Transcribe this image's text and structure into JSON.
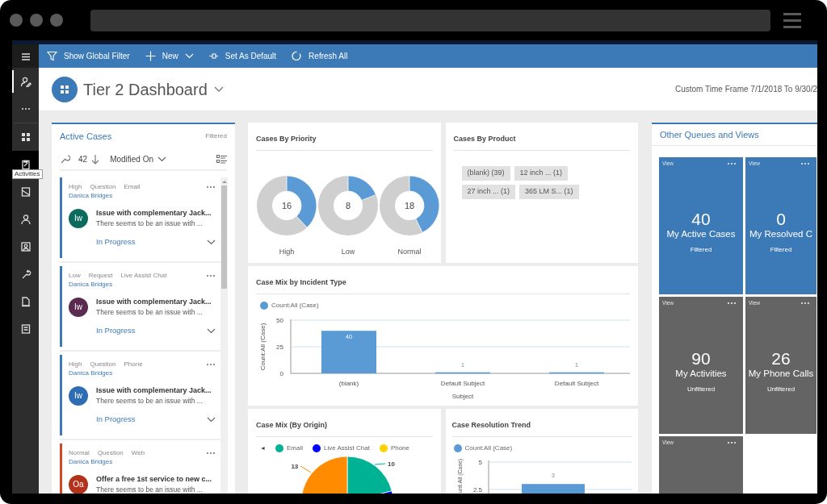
{
  "nav_rail": {
    "items": [
      {
        "selected": false,
        "hovered": false
      },
      {
        "selected": true,
        "hovered": false
      },
      {
        "selected": false,
        "hovered": false
      },
      {
        "selected": false,
        "hovered": false
      },
      {
        "selected": false,
        "hovered": true
      },
      {
        "selected": false,
        "hovered": false
      },
      {
        "selected": false,
        "hovered": false
      },
      {
        "selected": false,
        "hovered": false
      },
      {
        "selected": false,
        "hovered": false
      },
      {
        "selected": false,
        "hovered": false
      },
      {
        "selected": false,
        "hovered": false
      }
    ],
    "tooltip": "Activities"
  },
  "command_bar": [
    {
      "label": "Show Global Filter",
      "dropdown": false
    },
    {
      "label": "New",
      "dropdown": true
    },
    {
      "label": "Set As Default",
      "dropdown": false
    },
    {
      "label": "Refresh All",
      "dropdown": false
    }
  ],
  "header": {
    "title": "Tier 2 Dashboard",
    "time_frame": "Custom Time Frame 7/1/2018 To 9/30/2"
  },
  "active_cases": {
    "title": "Active Cases",
    "filter_label": "Filtered",
    "count": "42",
    "sort_field": "Modified On",
    "cases": [
      {
        "tags": [
          "High",
          "Question",
          "Email"
        ],
        "owner": "Danica Bridges",
        "avatar": {
          "initials": "Iw",
          "color": "#0d6b5e"
        },
        "title": "Issue with complementary Jack...",
        "description": "There seems to be an issue with ...",
        "status": "In Progress",
        "color": "#3b79b7"
      },
      {
        "tags": [
          "Low",
          "Request",
          "Live Assist Chat"
        ],
        "owner": "Danica Bridges",
        "avatar": {
          "initials": "Iw",
          "color": "#5b2a4f"
        },
        "title": "Issue with complementary Jack...",
        "description": "There seems to be an issue with ...",
        "status": "In Progress",
        "color": "#3b79b7"
      },
      {
        "tags": [
          "High",
          "Question",
          "Phone"
        ],
        "owner": "Danica Bridges",
        "avatar": {
          "initials": "Iw",
          "color": "#2e6db4"
        },
        "title": "Issue with complementary Jack...",
        "description": "There seems to be an issue with ...",
        "status": "In Progress",
        "color": "#3b79b7"
      },
      {
        "tags": [
          "Normal",
          "Question",
          "Web"
        ],
        "owner": "Danica Bridges",
        "avatar": {
          "initials": "Oa",
          "color": "#b3321b"
        },
        "title": "Offer a free 1st service to new c...",
        "description": "There seems to be an issue with ...",
        "color": "#d24726"
      }
    ]
  },
  "cases_by_priority": {
    "title": "Cases By Priority",
    "donuts": [
      {
        "label": "High",
        "count": "16"
      },
      {
        "label": "Low",
        "count": "8"
      },
      {
        "label": "Normal",
        "count": "18"
      }
    ]
  },
  "cases_by_product": {
    "title": "Cases By Product",
    "tags": [
      "(blank) (39)",
      "12 inch ... (1)",
      "27 inch ... (1)",
      "365 LM S... (1)"
    ]
  },
  "incident_chart": {
    "title": "Case Mix by Incident Type",
    "chart_data": {
      "type": "bar",
      "xlabel": "Subject",
      "ylabel": "Count:All (Case)",
      "categories": [
        "(blank)",
        "Default Subject",
        "Default Subject"
      ],
      "series": [
        {
          "name": "Count:All (Case)",
          "color": "#5b9bd5",
          "values": [
            40,
            1,
            1
          ]
        }
      ],
      "ylim": [
        0,
        50
      ],
      "yticks": [
        0,
        25,
        50
      ],
      "data_labels": true
    }
  },
  "origin_chart": {
    "title": "Case Mix (By Origin)",
    "legend_arrow": "◄",
    "legend": [
      {
        "name": "Email",
        "color": "#00b294"
      },
      {
        "name": "Live Assist Chat",
        "color": "#0000ff"
      },
      {
        "name": "Phone",
        "color": "#ffd200"
      }
    ],
    "slices": [
      {
        "color": "#00b294",
        "label": "10"
      },
      {
        "color": "#0000ff"
      },
      {
        "color": "#ff8c00",
        "label": "13"
      }
    ]
  },
  "resolution_chart": {
    "title": "Case Resolution Trend",
    "chart_data": {
      "type": "bar",
      "ylabel": "unt:All (Case)",
      "series": [
        {
          "name": "Count:All (Case)",
          "color": "#5b9bd5",
          "values": [
            3
          ]
        }
      ],
      "ylim": [
        0,
        5
      ],
      "yticks": [
        2.5,
        5
      ],
      "data_labels": true
    }
  },
  "queues": {
    "title": "Other Queues and Views",
    "tiles": [
      {
        "label": "View",
        "count": "40",
        "title": "My Active Cases",
        "filter": "Filtered",
        "color": "#3b79b7"
      },
      {
        "label": "View",
        "count": "0",
        "title": "My Resolved C",
        "filter": "Filtered",
        "color": "#3b79b7"
      },
      {
        "label": "View",
        "count": "90",
        "title": "My Activities",
        "filter": "Unfiltered",
        "color": "#646464"
      },
      {
        "label": "View",
        "count": "26",
        "title": "My Phone Calls",
        "filter": "Unfiltered",
        "color": "#646464"
      },
      {
        "label": "View",
        "color": "#646464"
      }
    ]
  }
}
